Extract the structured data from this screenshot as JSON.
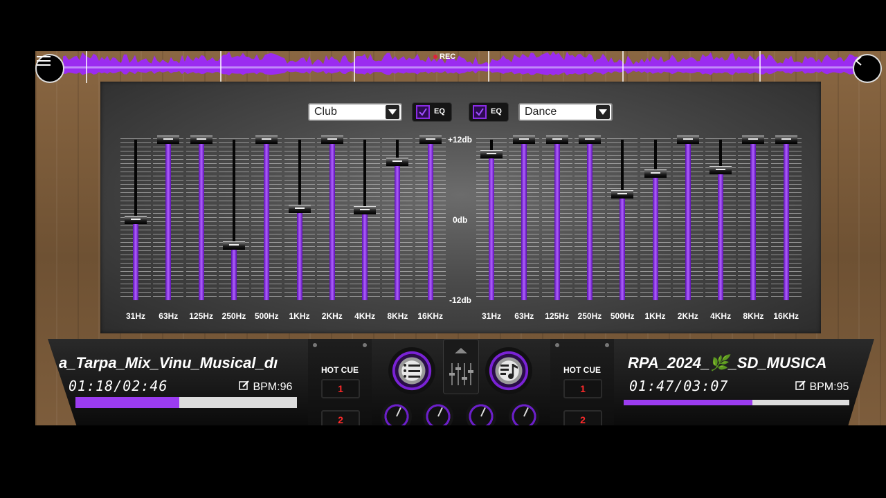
{
  "topbar": {
    "rec_label": "REC"
  },
  "left_eq": {
    "preset": "Club",
    "eq_enabled": true,
    "eq_label": "EQ",
    "bands": [
      {
        "freq": "31Hz",
        "level": 0.5
      },
      {
        "freq": "63Hz",
        "level": 1.0
      },
      {
        "freq": "125Hz",
        "level": 1.0
      },
      {
        "freq": "250Hz",
        "level": 0.34
      },
      {
        "freq": "500Hz",
        "level": 1.0
      },
      {
        "freq": "1KHz",
        "level": 0.57
      },
      {
        "freq": "2KHz",
        "level": 1.0
      },
      {
        "freq": "4KHz",
        "level": 0.56
      },
      {
        "freq": "8KHz",
        "level": 0.86
      },
      {
        "freq": "16KHz",
        "level": 1.0
      }
    ]
  },
  "right_eq": {
    "preset": "Dance",
    "eq_enabled": true,
    "eq_label": "EQ",
    "bands": [
      {
        "freq": "31Hz",
        "level": 0.91
      },
      {
        "freq": "63Hz",
        "level": 1.0
      },
      {
        "freq": "125Hz",
        "level": 1.0
      },
      {
        "freq": "250Hz",
        "level": 1.0
      },
      {
        "freq": "500Hz",
        "level": 0.66
      },
      {
        "freq": "1KHz",
        "level": 0.79
      },
      {
        "freq": "2KHz",
        "level": 1.0
      },
      {
        "freq": "4KHz",
        "level": 0.81
      },
      {
        "freq": "8KHz",
        "level": 1.0
      },
      {
        "freq": "16KHz",
        "level": 1.0
      }
    ]
  },
  "db_scale": {
    "top": "+12db",
    "mid": "0db",
    "bottom": "-12db"
  },
  "deck_left": {
    "track": "a_Tarpa_Mix_Vinu_Musical_dı",
    "time": "01:18/02:46",
    "bpm": "BPM:96",
    "progress": 0.47
  },
  "deck_right": {
    "track": "RPA_2024_🌿_SD_MUSICA",
    "time": "01:47/03:07",
    "bpm": "BPM:95",
    "progress": 0.57
  },
  "hot_cue": {
    "title": "HOT CUE",
    "cue1": "1",
    "cue2": "2"
  },
  "colors": {
    "accent": "#8b2ce6",
    "cue": "#ff2a2a"
  }
}
